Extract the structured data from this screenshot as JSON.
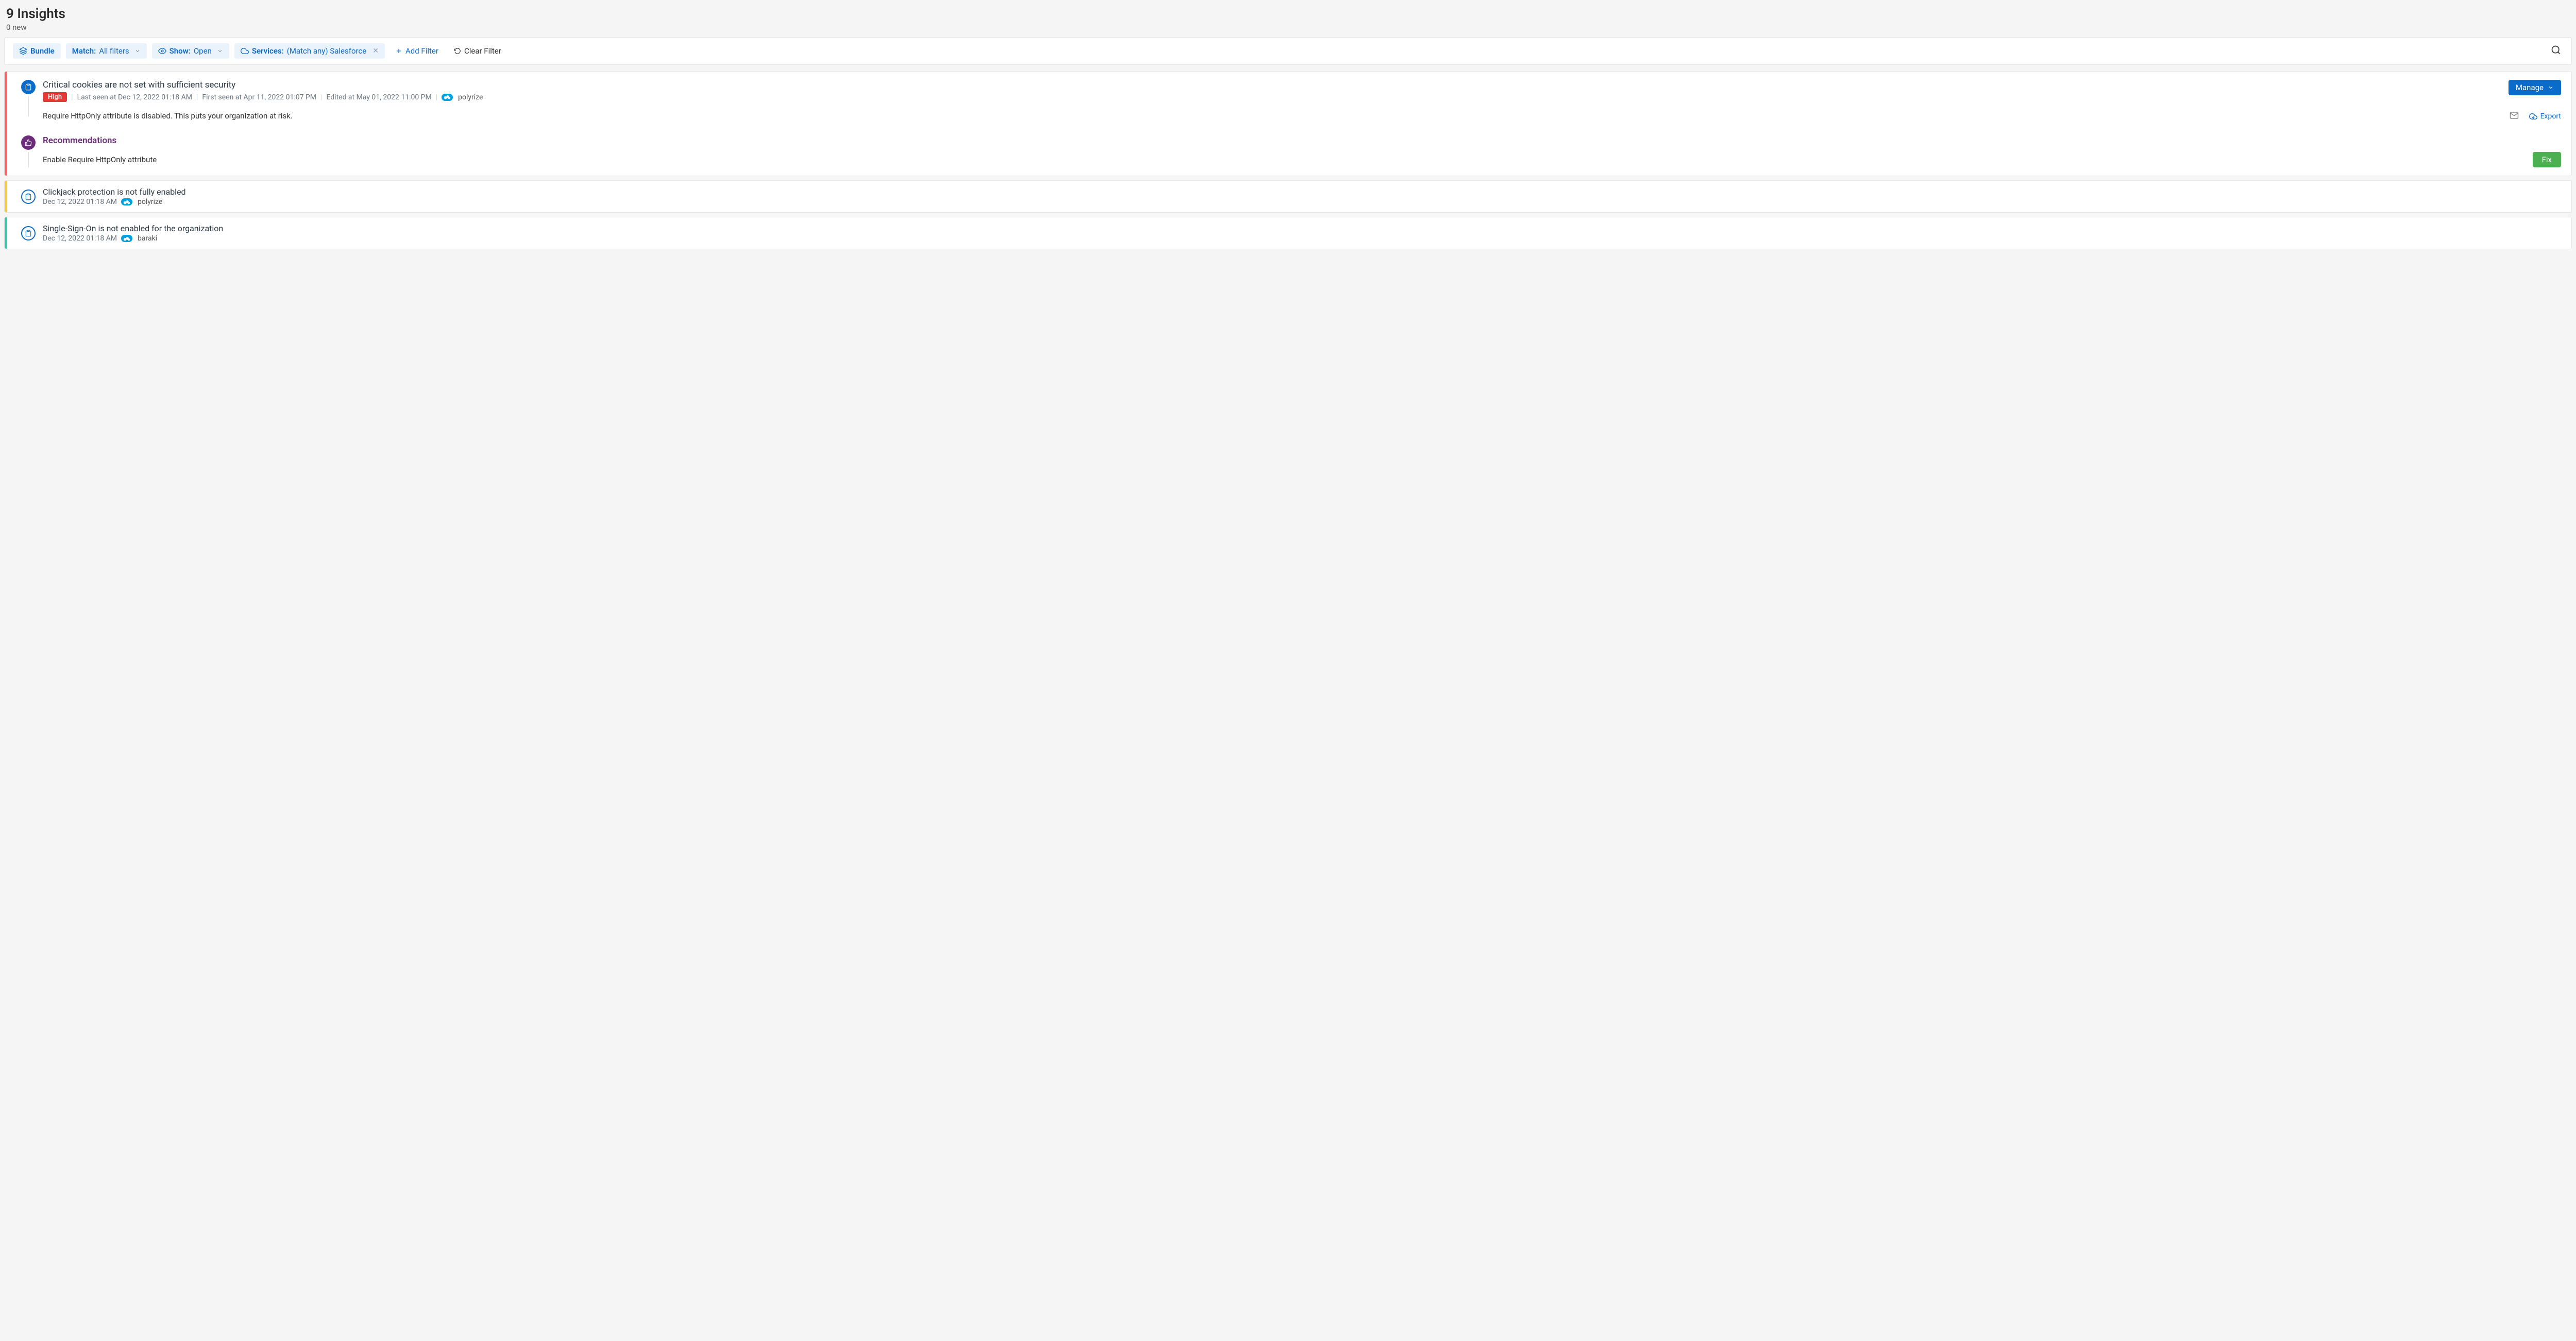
{
  "header": {
    "title": "9 Insights",
    "subtitle": "0 new"
  },
  "filters": {
    "bundle_label": "Bundle",
    "match_label": "Match:",
    "match_value": "All filters",
    "show_label": "Show:",
    "show_value": "Open",
    "services_label": "Services:",
    "services_value": "(Match any) Salesforce",
    "add_filter": "Add Filter",
    "clear_filter": "Clear Filter"
  },
  "card1": {
    "title": "Critical cookies are not set with sufficient security",
    "severity": "High",
    "last_seen": "Last seen at Dec 12, 2022 01:18 AM",
    "first_seen": "First seen at Apr 11, 2022 01:07 PM",
    "edited": "Edited at May 01, 2022 11:00 PM",
    "service": "polyrize",
    "description": "Require HttpOnly attribute is disabled. This puts your organization at risk.",
    "manage": "Manage",
    "export": "Export",
    "rec_header": "Recommendations",
    "rec_text": "Enable Require HttpOnly attribute",
    "fix": "Fix"
  },
  "card2": {
    "title": "Clickjack protection is not fully enabled",
    "ts": "Dec 12, 2022 01:18 AM",
    "service": "polyrize"
  },
  "card3": {
    "title": "Single-Sign-On is not enabled for the organization",
    "ts": "Dec 12, 2022 01:18 AM",
    "service": "baraki"
  }
}
